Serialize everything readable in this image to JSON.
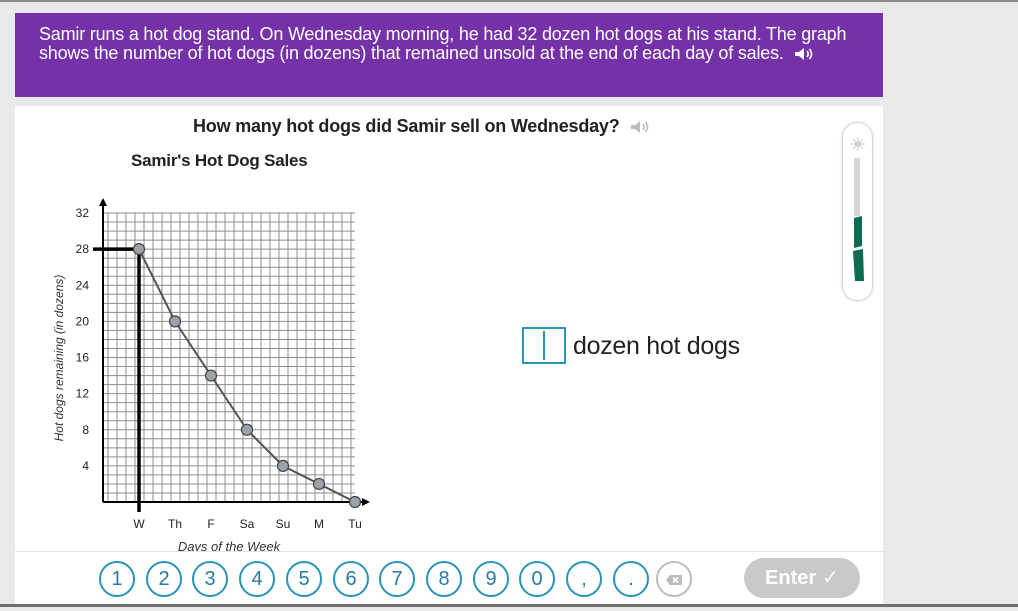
{
  "problem": {
    "text": "Samir runs a hot dog stand. On Wednesday morning, he had 32 dozen hot dogs at his stand. The graph shows the number of hot dogs (in dozens) that remained unsold at the end of each day of sales.",
    "speaker_icon": "speaker-icon"
  },
  "question": {
    "text": "How many hot dogs did Samir sell on Wednesday?",
    "speaker_icon": "speaker-icon"
  },
  "chart_data": {
    "type": "line",
    "title": "Samir's Hot Dog Sales",
    "xlabel": "Days of the Week",
    "ylabel": "Hot dogs remaining (in dozens)",
    "categories": [
      "W",
      "Th",
      "F",
      "Sa",
      "Su",
      "M",
      "Tu"
    ],
    "y_ticks": [
      "4",
      "8",
      "12",
      "16",
      "20",
      "24",
      "28",
      "32"
    ],
    "values": [
      28,
      20,
      14,
      8,
      4,
      2,
      0
    ],
    "ylim": [
      0,
      32
    ],
    "grid": true,
    "highlight": {
      "category": "W",
      "value": 28
    },
    "line_color": "#555555",
    "marker_color": "#9aa3aa",
    "highlight_color": "#000000"
  },
  "answer": {
    "unit_label": "dozen hot dogs",
    "value": ""
  },
  "keypad": {
    "keys": [
      "1",
      "2",
      "3",
      "4",
      "5",
      "6",
      "7",
      "8",
      "9",
      "0",
      ",",
      "."
    ],
    "delete_icon": "backspace-icon",
    "enter_label": "Enter",
    "enter_icon": "checkmark-icon"
  },
  "colors": {
    "banner": "#7532a8",
    "accent": "#2a93b8",
    "progress_fill": "#0d6b4f"
  }
}
